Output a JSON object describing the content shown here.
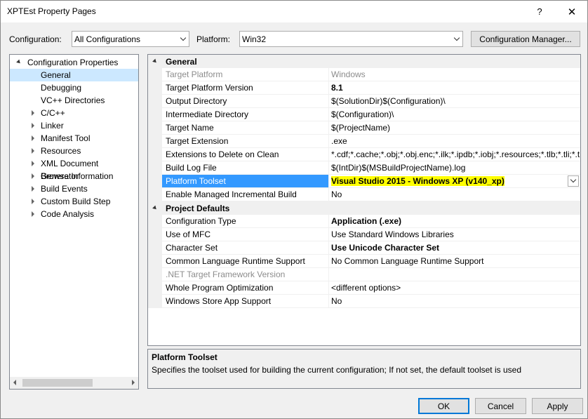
{
  "window": {
    "title": "XPTEst Property Pages",
    "help_glyph": "?",
    "close_glyph": "✕"
  },
  "toolbar": {
    "configuration_label": "Configuration:",
    "configuration_value": "All Configurations",
    "platform_label": "Platform:",
    "platform_value": "Win32",
    "config_manager_label": "Configuration Manager..."
  },
  "tree": {
    "root": "Configuration Properties",
    "items": [
      {
        "label": "General",
        "selected": true,
        "expandable": false
      },
      {
        "label": "Debugging",
        "expandable": false
      },
      {
        "label": "VC++ Directories",
        "expandable": false
      },
      {
        "label": "C/C++",
        "expandable": true
      },
      {
        "label": "Linker",
        "expandable": true
      },
      {
        "label": "Manifest Tool",
        "expandable": true
      },
      {
        "label": "Resources",
        "expandable": true
      },
      {
        "label": "XML Document Generator",
        "expandable": true
      },
      {
        "label": "Browse Information",
        "expandable": true
      },
      {
        "label": "Build Events",
        "expandable": true
      },
      {
        "label": "Custom Build Step",
        "expandable": true
      },
      {
        "label": "Code Analysis",
        "expandable": true
      }
    ]
  },
  "grid": {
    "categories": [
      {
        "name": "General",
        "properties": [
          {
            "name": "Target Platform",
            "value": "Windows",
            "style": "gray"
          },
          {
            "name": "Target Platform Version",
            "value": "8.1",
            "style": "bold"
          },
          {
            "name": "Output Directory",
            "value": "$(SolutionDir)$(Configuration)\\",
            "style": ""
          },
          {
            "name": "Intermediate Directory",
            "value": "$(Configuration)\\",
            "style": ""
          },
          {
            "name": "Target Name",
            "value": "$(ProjectName)",
            "style": ""
          },
          {
            "name": "Target Extension",
            "value": ".exe",
            "style": ""
          },
          {
            "name": "Extensions to Delete on Clean",
            "value": "*.cdf;*.cache;*.obj;*.obj.enc;*.ilk;*.ipdb;*.iobj;*.resources;*.tlb;*.tli;*.t",
            "style": ""
          },
          {
            "name": "Build Log File",
            "value": "$(IntDir)$(MSBuildProjectName).log",
            "style": ""
          },
          {
            "name": "Platform Toolset",
            "value": "Visual Studio 2015 - Windows XP (v140_xp)",
            "style": "selected"
          },
          {
            "name": "Enable Managed Incremental Build",
            "value": "No",
            "style": ""
          }
        ]
      },
      {
        "name": "Project Defaults",
        "properties": [
          {
            "name": "Configuration Type",
            "value": "Application (.exe)",
            "style": "bold"
          },
          {
            "name": "Use of MFC",
            "value": "Use Standard Windows Libraries",
            "style": ""
          },
          {
            "name": "Character Set",
            "value": "Use Unicode Character Set",
            "style": "bold"
          },
          {
            "name": "Common Language Runtime Support",
            "value": "No Common Language Runtime Support",
            "style": ""
          },
          {
            "name": ".NET Target Framework Version",
            "value": "",
            "style": "gray"
          },
          {
            "name": "Whole Program Optimization",
            "value": "<different options>",
            "style": ""
          },
          {
            "name": "Windows Store App Support",
            "value": "No",
            "style": ""
          }
        ]
      }
    ]
  },
  "description": {
    "title": "Platform Toolset",
    "text": "Specifies the toolset used for building the current configuration; If not set, the default toolset is used"
  },
  "buttons": {
    "ok": "OK",
    "cancel": "Cancel",
    "apply": "Apply"
  },
  "colors": {
    "selection": "#3399ff",
    "highlight": "#ffff00",
    "tree_selection": "#cce8ff"
  }
}
